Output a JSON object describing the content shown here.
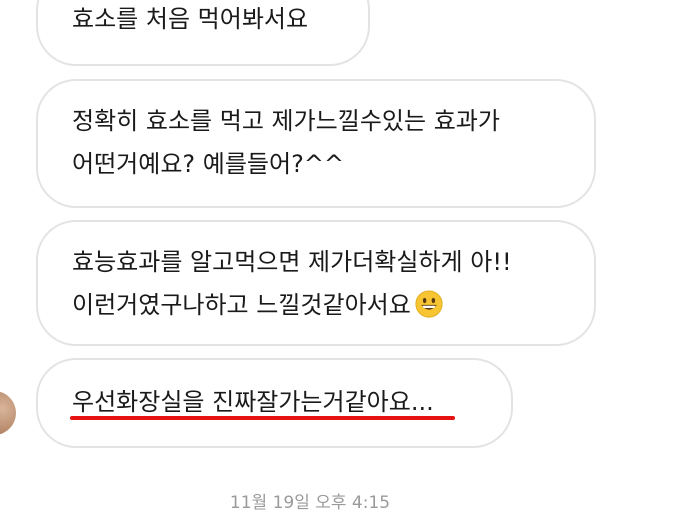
{
  "messages": [
    {
      "lines": [
        "효소를 처음 먹어봐서요"
      ]
    },
    {
      "lines": [
        "정확히 효소를 먹고 제가느낄수있는 효과가",
        "어떤거예요? 예를들어?^^"
      ]
    },
    {
      "lines": [
        "효능효과를 알고먹으면 제가더확실하게 아!!",
        "이런거였구나하고 느낄것같아서요"
      ],
      "trailing_emoji": "grinning-face"
    },
    {
      "lines": [
        "우선화장실을 진짜잘가는거같아요..."
      ]
    }
  ],
  "timestamp": "11월 19일 오후 4:15",
  "colors": {
    "bubble_border": "#e3e3e3",
    "text": "#1a1a1a",
    "timestamp": "#9a9a9a",
    "highlight_underline": "#e61212",
    "emoji_face": "#f7c531"
  }
}
